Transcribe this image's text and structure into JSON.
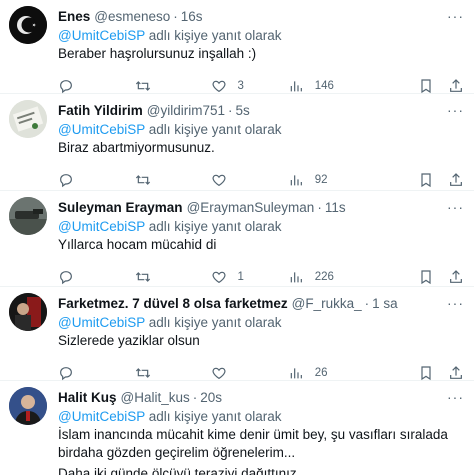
{
  "reply_prefix": "",
  "reply_mention": "@UmitCebiSP",
  "reply_suffix": " adlı kişiye yanıt olarak",
  "separator": "·",
  "more_glyph": "···",
  "tweets": [
    {
      "name": "Enes",
      "handle": "@esmeneso",
      "time": "16s",
      "text": "Beraber haşrolursunuz inşallah :)",
      "likes": "3",
      "views": "146"
    },
    {
      "name": "Fatih Yildirim",
      "handle": "@yildirim751",
      "time": "5s",
      "text": "Biraz abartmiyormusunuz.",
      "likes": "",
      "views": "92"
    },
    {
      "name": "Suleyman Erayman",
      "handle": "@EraymanSuleyman",
      "time": "11s",
      "text": "Yıllarca hocam mücahid di",
      "likes": "1",
      "views": "226"
    },
    {
      "name": "Farketmez. 7 düvel 8 olsa farketmez",
      "handle": "@F_rukka_",
      "time": "1 sa",
      "text": "Sizlerede yaziklar olsun",
      "likes": "",
      "views": "26"
    },
    {
      "name": "Halit Kuş",
      "handle": "@Halit_kus",
      "time": "20s",
      "text": "İslam inancında mücahit kime denir ümit bey, şu vasıfları sıralada birdaha gözden geçirelim öğrenelerim...",
      "text2": "Daha iki günde ölçüyü teraziyi dağıttınız,"
    }
  ]
}
